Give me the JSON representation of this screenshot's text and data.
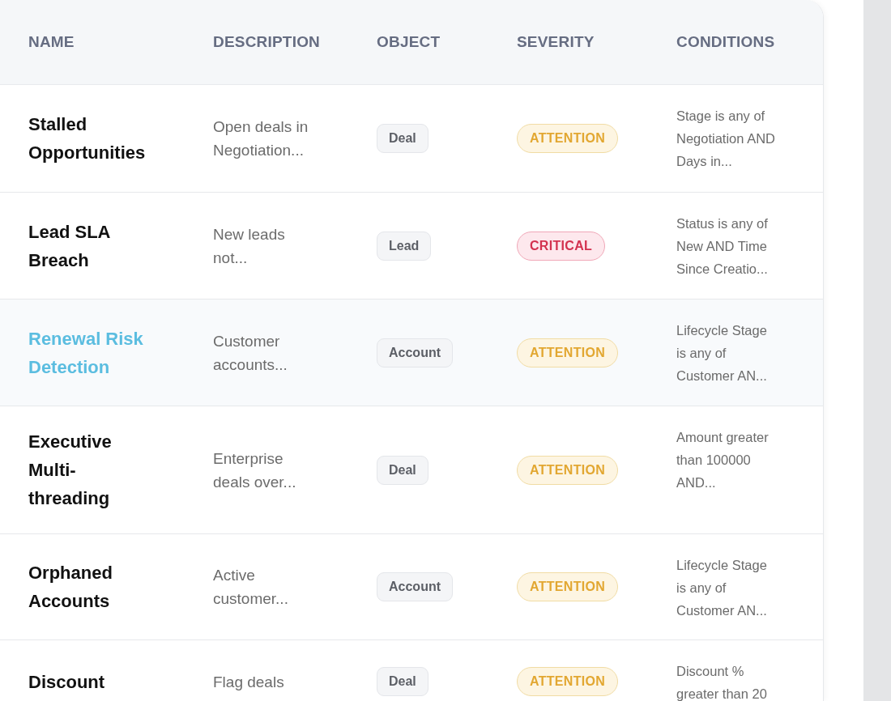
{
  "table": {
    "columns": [
      "NAME",
      "DESCRIPTION",
      "OBJECT",
      "SEVERITY",
      "CONDITIONS"
    ],
    "rows": [
      {
        "name": "Stalled Opportunities",
        "description": "Open deals in Negotiation...",
        "object": "Deal",
        "severity": {
          "label": "ATTENTION",
          "kind": "attention"
        },
        "conditions": "Stage is any of Negotiation AND Days in...",
        "selected": false
      },
      {
        "name": "Lead SLA Breach",
        "description": "New leads not...",
        "object": "Lead",
        "severity": {
          "label": "CRITICAL",
          "kind": "critical"
        },
        "conditions": "Status is any of New AND Time Since Creatio...",
        "selected": false
      },
      {
        "name": "Renewal Risk Detection",
        "description": "Customer accounts...",
        "object": "Account",
        "severity": {
          "label": "ATTENTION",
          "kind": "attention"
        },
        "conditions": "Lifecycle Stage is any of Customer AN...",
        "selected": true
      },
      {
        "name": "Executive Multi-threading",
        "description": "Enterprise deals over...",
        "object": "Deal",
        "severity": {
          "label": "ATTENTION",
          "kind": "attention"
        },
        "conditions": "Amount greater than 100000 AND...",
        "selected": false
      },
      {
        "name": "Orphaned Accounts",
        "description": "Active customer...",
        "object": "Account",
        "severity": {
          "label": "ATTENTION",
          "kind": "attention"
        },
        "conditions": "Lifecycle Stage is any of Customer AN...",
        "selected": false
      },
      {
        "name": "Discount",
        "description": "Flag deals",
        "object": "Deal",
        "severity": {
          "label": "ATTENTION",
          "kind": "attention"
        },
        "conditions": "Discount % greater than 20",
        "selected": false
      }
    ]
  }
}
